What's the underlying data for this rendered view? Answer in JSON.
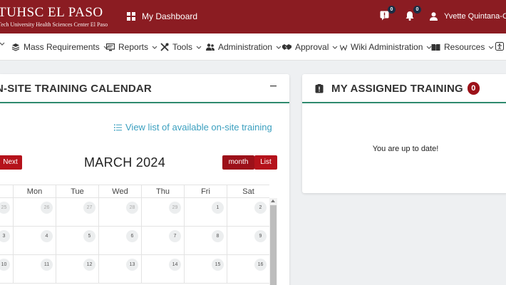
{
  "brand": {
    "title": "TUHSC EL PASO",
    "subtitle": "Tech University Health Sciences Center El Paso"
  },
  "header": {
    "dashboard_label": "My Dashboard",
    "messages_count": "0",
    "notifications_count": "0",
    "user_name": "Yvette Quintana-Ch"
  },
  "menu": {
    "items": [
      {
        "label": "Mass Requirements",
        "icon": "layers-icon"
      },
      {
        "label": "Reports",
        "icon": "report-icon"
      },
      {
        "label": "Tools",
        "icon": "tools-icon"
      },
      {
        "label": "Administration",
        "icon": "users-icon"
      },
      {
        "label": "Approval",
        "icon": "handshake-icon"
      },
      {
        "label": "Wiki Administration",
        "icon": "wikipedia-icon"
      },
      {
        "label": "Resources",
        "icon": "book-icon"
      }
    ]
  },
  "calendar_card": {
    "title": "N-SITE TRAINING CALENDAR",
    "view_list_label": "View list of available on-site training",
    "next_label": "Next",
    "month_title": "MARCH 2024",
    "view_month_label": "month",
    "view_list_toggle_label": "List",
    "days_of_week": [
      "",
      "Mon",
      "Tue",
      "Wed",
      "Thu",
      "Fri",
      "Sat"
    ],
    "weeks": [
      [
        {
          "d": "25",
          "other": true
        },
        {
          "d": "26",
          "other": true
        },
        {
          "d": "27",
          "other": true
        },
        {
          "d": "28",
          "other": true
        },
        {
          "d": "29",
          "other": true
        },
        {
          "d": "1",
          "other": false
        },
        {
          "d": "2",
          "other": false
        }
      ],
      [
        {
          "d": "3",
          "other": false
        },
        {
          "d": "4",
          "other": false
        },
        {
          "d": "5",
          "other": false
        },
        {
          "d": "6",
          "other": false
        },
        {
          "d": "7",
          "other": false
        },
        {
          "d": "8",
          "other": false
        },
        {
          "d": "9",
          "other": false
        }
      ],
      [
        {
          "d": "10",
          "other": false
        },
        {
          "d": "11",
          "other": false
        },
        {
          "d": "12",
          "other": false
        },
        {
          "d": "13",
          "other": false
        },
        {
          "d": "14",
          "other": false
        },
        {
          "d": "15",
          "other": false
        },
        {
          "d": "16",
          "other": false
        }
      ]
    ]
  },
  "assigned_card": {
    "title": "MY ASSIGNED TRAINING",
    "count": "0",
    "empty_message": "You are up to date!"
  },
  "colors": {
    "brand_red": "#8b1c22",
    "button_red": "#b5121b",
    "accent_green": "#2f8a6e",
    "link_blue": "#3a9fbf",
    "badge_navy": "#1b2d44"
  }
}
